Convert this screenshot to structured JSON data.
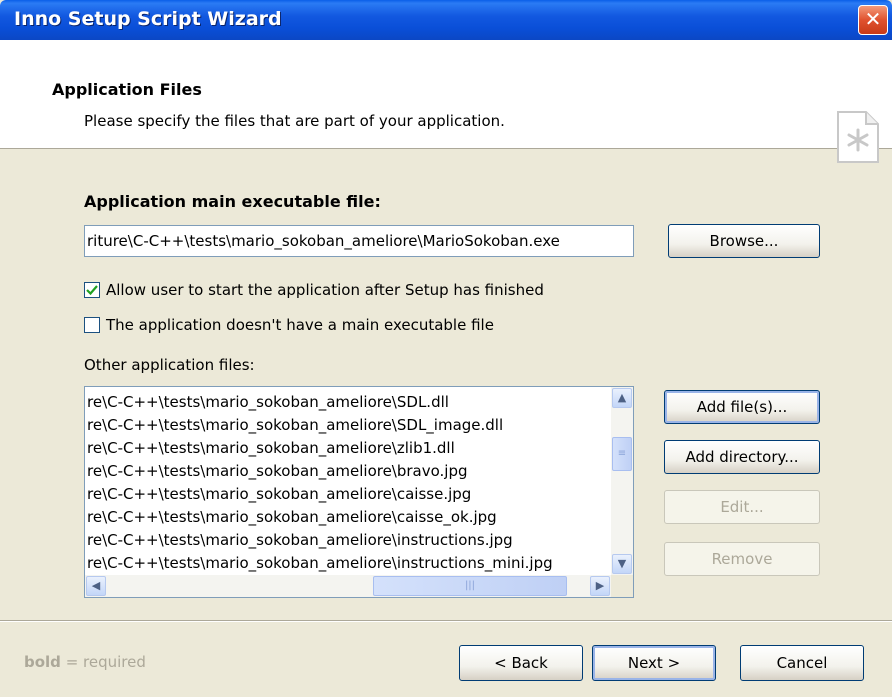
{
  "window": {
    "title": "Inno Setup Script Wizard",
    "close_glyph": "✕"
  },
  "header": {
    "title": "Application Files",
    "subtitle": "Please specify the files that are part of your application.",
    "icon": "page-star-icon"
  },
  "main_exe": {
    "label": "Application main executable file:",
    "value": "riture\\C-C++\\tests\\mario_sokoban_ameliore\\MarioSokoban.exe",
    "browse_label": "Browse..."
  },
  "options": {
    "allow_start": {
      "label": "Allow user to start the application after Setup has finished",
      "checked": true
    },
    "no_main_exe": {
      "label": "The application doesn't have a main executable file",
      "checked": false
    }
  },
  "other_files": {
    "label": "Other application files:",
    "items": [
      "re\\C-C++\\tests\\mario_sokoban_ameliore\\SDL.dll",
      "re\\C-C++\\tests\\mario_sokoban_ameliore\\SDL_image.dll",
      "re\\C-C++\\tests\\mario_sokoban_ameliore\\zlib1.dll",
      "re\\C-C++\\tests\\mario_sokoban_ameliore\\bravo.jpg",
      "re\\C-C++\\tests\\mario_sokoban_ameliore\\caisse.jpg",
      "re\\C-C++\\tests\\mario_sokoban_ameliore\\caisse_ok.jpg",
      "re\\C-C++\\tests\\mario_sokoban_ameliore\\instructions.jpg",
      "re\\C-C++\\tests\\mario_sokoban_ameliore\\instructions_mini.jpg"
    ],
    "buttons": {
      "add_files": "Add file(s)...",
      "add_directory": "Add directory...",
      "edit": "Edit...",
      "remove": "Remove"
    }
  },
  "footer": {
    "hint_bold": "bold",
    "hint_rest": " = required",
    "back": "< Back",
    "next": "Next >",
    "cancel": "Cancel"
  }
}
